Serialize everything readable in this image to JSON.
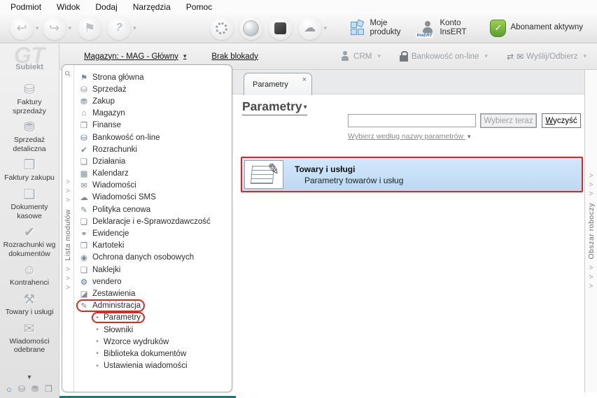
{
  "glyphs": {
    "caret_down": "▾",
    "caret_down_big": "▼",
    "chevron": ">",
    "close": "×",
    "check": "✓",
    "pin": "⚲",
    "back": "↩",
    "forward": "↪",
    "flag": "⚑",
    "help": "?",
    "cloud": "☁",
    "send_arrows": "⇄",
    "envelope": "✉",
    "pen": "✎"
  },
  "menubar": {
    "items": [
      "Podmiot",
      "Widok",
      "Dodaj",
      "Narzędzia",
      "Pomoc"
    ]
  },
  "toolbar": {
    "moje_produkty": "Moje produkty",
    "konto_insert": "Konto InsERT",
    "insert_badge": "InsERT",
    "abonament": "Abonament aktywny"
  },
  "subtoolbar": {
    "magazyn_link": "Magazyn: - MAG - Główny",
    "brak_blokady": "Brak blokady",
    "crm": "CRM",
    "bankowosc": "Bankowość on-line",
    "wyslij_odbierz": "Wyślij/Odbierz"
  },
  "sidebar": {
    "brand_watermark": "GT",
    "brand": "Subiekt",
    "items": [
      {
        "label": "Faktury sprzedaży",
        "icon": "⛁"
      },
      {
        "label": "Sprzedaż detaliczna",
        "icon": "⛃"
      },
      {
        "label": "Faktury zakupu",
        "icon": "❒"
      },
      {
        "label": "Dokumenty kasowe",
        "icon": "❏"
      },
      {
        "label": "Rozrachunki wg dokumentów",
        "icon": "✔"
      },
      {
        "label": "Kontrahenci",
        "icon": "☺"
      },
      {
        "label": "Towary i usługi",
        "icon": "⚒"
      },
      {
        "label": "Wiadomości odebrane",
        "icon": "✉"
      }
    ],
    "footer_icons": [
      {
        "icon": "○",
        "cls": "sel"
      },
      {
        "icon": "⛁",
        "cls": ""
      },
      {
        "icon": "⛃",
        "cls": ""
      },
      {
        "icon": "❒",
        "cls": ""
      }
    ]
  },
  "module_panel": {
    "strip_label": "Lista modułów",
    "items": [
      {
        "label": "Strona główna",
        "icon": "⚑",
        "cls": ""
      },
      {
        "label": "Sprzedaż",
        "icon": "⛁",
        "cls": ""
      },
      {
        "label": "Zakup",
        "icon": "⛃",
        "cls": ""
      },
      {
        "label": "Magazyn",
        "icon": "⌂",
        "cls": ""
      },
      {
        "label": "Finanse",
        "icon": "❐",
        "cls": ""
      },
      {
        "label": "Bankowość on-line",
        "icon": "⛁",
        "cls": "ib"
      },
      {
        "label": "Rozrachunki",
        "icon": "✔",
        "cls": ""
      },
      {
        "label": "Działania",
        "icon": "❏",
        "cls": ""
      },
      {
        "label": "Kalendarz",
        "icon": "▦",
        "cls": ""
      },
      {
        "label": "Wiadomości",
        "icon": "✉",
        "cls": ""
      },
      {
        "label": "Wiadomości SMS",
        "icon": "☁",
        "cls": ""
      },
      {
        "label": "Polityka cenowa",
        "icon": "✎",
        "cls": ""
      },
      {
        "label": "Deklaracje i e-Sprawozdawczość",
        "icon": "❏",
        "cls": ""
      },
      {
        "label": "Ewidencje",
        "icon": "⚭",
        "cls": ""
      },
      {
        "label": "Kartoteki",
        "icon": "❒",
        "cls": ""
      },
      {
        "label": "Ochrona danych osobowych",
        "icon": "◉",
        "cls": ""
      },
      {
        "label": "Naklejki",
        "icon": "❑",
        "cls": ""
      },
      {
        "label": "vendero",
        "icon": "⚙",
        "cls": "ib"
      },
      {
        "label": "Zestawienia",
        "icon": "◪",
        "cls": ""
      },
      {
        "label": "Administracja",
        "icon": "✎",
        "cls": "ring"
      },
      {
        "label": "Parametry",
        "icon": "•",
        "cls": "sub ring"
      },
      {
        "label": "Słowniki",
        "icon": "•",
        "cls": "sub"
      },
      {
        "label": "Wzorce wydruków",
        "icon": "•",
        "cls": "sub"
      },
      {
        "label": "Biblioteka dokumentów",
        "icon": "•",
        "cls": "sub"
      },
      {
        "label": "Ustawienia wiadomości",
        "icon": "•",
        "cls": "sub"
      }
    ]
  },
  "main": {
    "tab_label": "Parametry",
    "title": "Parametry",
    "search_value": "",
    "select_now": "Wybierz teraz",
    "clear": "Wyczyść",
    "by_name_link": "Wybierz według nazwy parametrów",
    "result_title": "Towary i usługi",
    "result_subtitle": "Parametry towarów i usług"
  },
  "right_panel": {
    "strip_label": "Obszar roboczy"
  }
}
